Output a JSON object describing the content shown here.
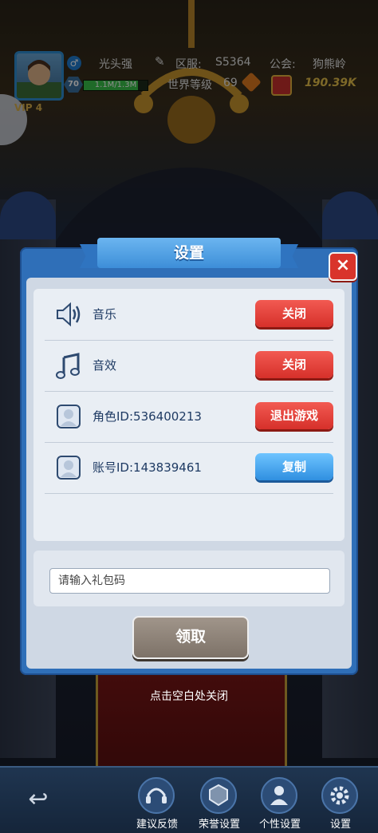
{
  "player": {
    "name": "光头强",
    "server_label": "区服:",
    "server_value": "S5364",
    "guild_label": "公会:",
    "guild_value": "狗熊岭",
    "level": "70",
    "exp": "1.1M/1.3M",
    "exp_fraction": 0.85,
    "world_level_label": "世界等级",
    "world_level_value": "69",
    "power": "190.39K",
    "vip_label": "VIP",
    "vip_value": "4"
  },
  "dialog": {
    "title": "设置",
    "close_icon": "×",
    "rows": [
      {
        "label": "音乐",
        "icon": "speaker-icon",
        "button": "关闭",
        "button_color": "#d6302a"
      },
      {
        "label": "音效",
        "icon": "music-note-icon",
        "button": "关闭",
        "button_color": "#d6302a"
      },
      {
        "label": "角色ID:536400213",
        "icon": "avatar-frame-icon",
        "button": "退出游戏",
        "button_color": "#d6302a"
      },
      {
        "label": "账号ID:143839461",
        "icon": "avatar-frame-icon",
        "button": "复制",
        "button_color": "#2f8fe0"
      }
    ],
    "gift_placeholder": "请输入礼包码",
    "claim_button": "领取",
    "close_hint": "点击空白处关闭"
  },
  "bottom_nav": {
    "back_icon": "↩",
    "items": [
      {
        "label": "建议反馈",
        "icon": "headset-icon"
      },
      {
        "label": "荣誉设置",
        "icon": "honor-badge-icon"
      },
      {
        "label": "个性设置",
        "icon": "person-icon"
      },
      {
        "label": "设置",
        "icon": "gear-icon"
      }
    ]
  }
}
